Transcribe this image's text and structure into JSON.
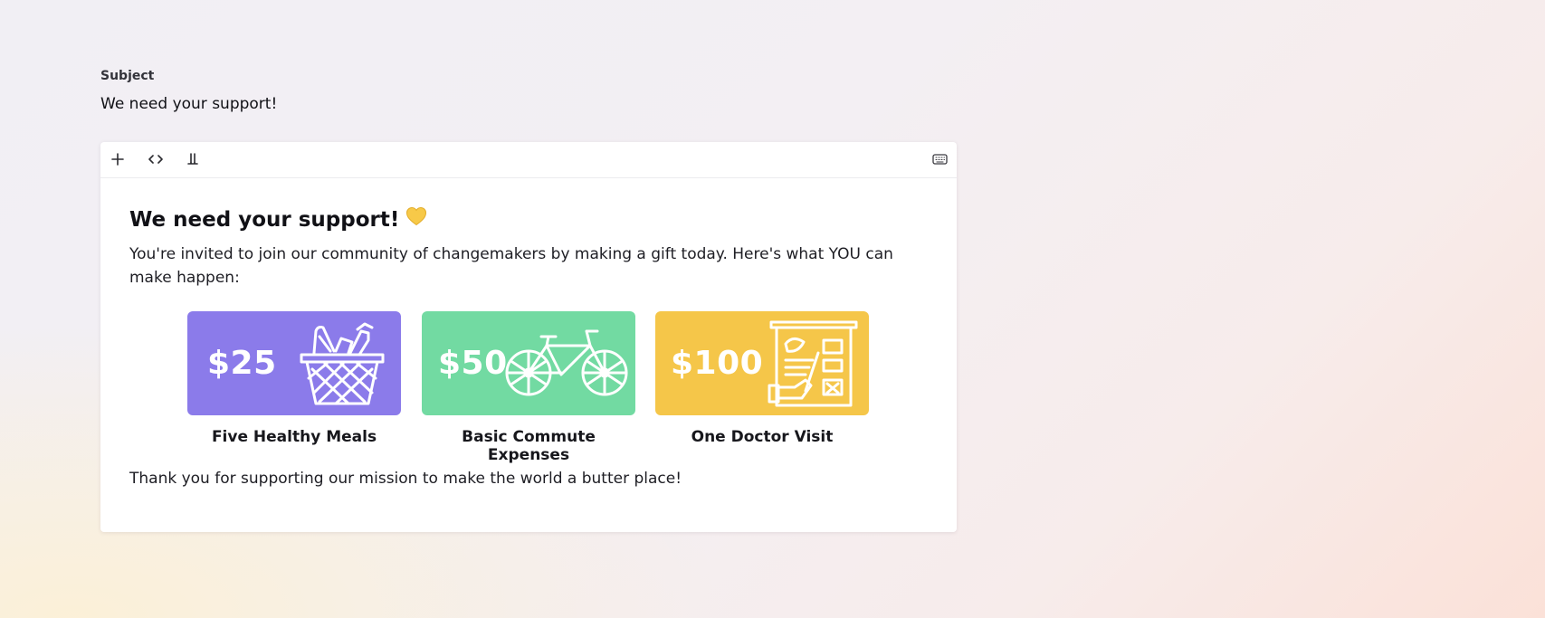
{
  "subject": {
    "label": "Subject",
    "value": "We need your support!"
  },
  "toolbar": {
    "items": [
      {
        "name": "add",
        "icon": "plus-icon"
      },
      {
        "name": "code",
        "icon": "code-icon"
      },
      {
        "name": "test",
        "icon": "flask-icon"
      }
    ],
    "right_icon": "keyboard-icon"
  },
  "email": {
    "heading": "We need your support!",
    "heading_icon": "yellow-heart-icon",
    "intro": "You're invited to join our community of changemakers by making a gift today. Here's what YOU can make happen:",
    "cards": [
      {
        "amount": "$25",
        "caption": "Five Healthy Meals",
        "icon": "basket-icon",
        "color": "#8b7bea"
      },
      {
        "amount": "$50",
        "caption": "Basic Commute Expenses",
        "icon": "bicycle-icon",
        "color": "#72daa2"
      },
      {
        "amount": "$100",
        "caption": "One Doctor Visit",
        "icon": "clipboard-icon",
        "color": "#f5c649"
      }
    ],
    "closing": "Thank you for supporting our mission to make the world a butter place!"
  },
  "colors": {
    "heart": "#f7c948",
    "text": "#1e1e24"
  }
}
